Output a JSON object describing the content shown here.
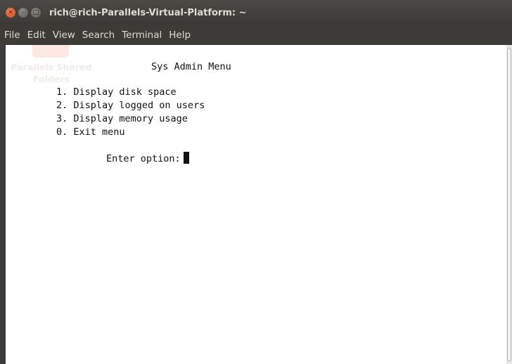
{
  "window": {
    "title": "rich@rich-Parallels-Virtual-Platform: ~",
    "close_glyph": "×",
    "minimize_glyph": "–",
    "maximize_glyph": "□"
  },
  "menubar": {
    "items": [
      "File",
      "Edit",
      "View",
      "Search",
      "Terminal",
      "Help"
    ]
  },
  "desktop_icon": {
    "label_line1": "Parallels Shared",
    "label_line2": "Folders"
  },
  "terminal": {
    "title": "Sys Admin Menu",
    "options": [
      "1. Display disk space",
      "2. Display logged on users",
      "3. Display memory usage",
      "0. Exit menu"
    ],
    "prompt": "Enter option:"
  },
  "colors": {
    "titlebar": "#3c3b37",
    "close_button": "#e0562c",
    "terminal_background": "#ffffff",
    "terminal_text": "#111111"
  }
}
